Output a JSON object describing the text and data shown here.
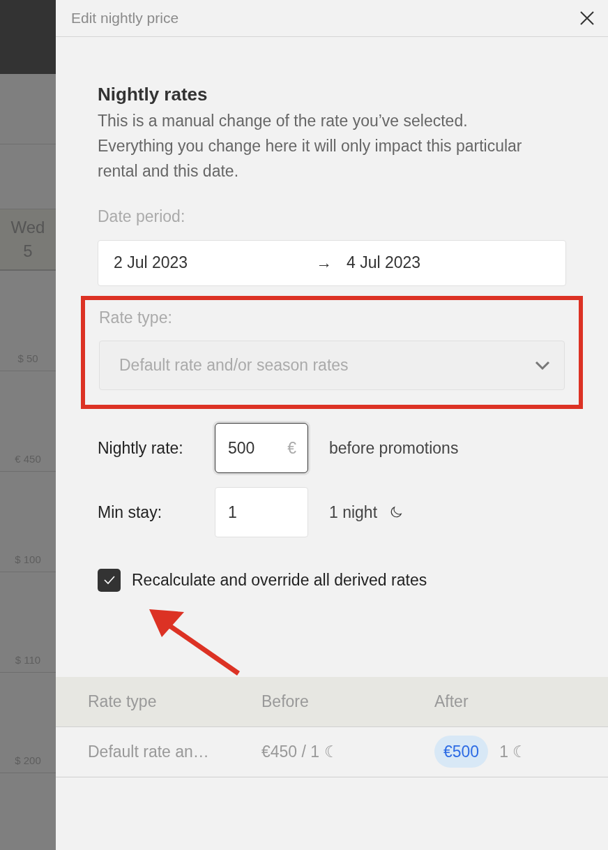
{
  "calendar": {
    "day": {
      "weekday": "Wed",
      "date": "5"
    },
    "prices": [
      "$ 50",
      "€ 450",
      "$ 100",
      "$ 110",
      "$ 200"
    ]
  },
  "dialog": {
    "title": "Edit nightly price",
    "heading": "Nightly rates",
    "description": "This is a manual change of the rate you’ve selected. Everything you change here it will only impact this particular rental and this date.",
    "date_period": {
      "label": "Date period:",
      "start": "2 Jul 2023",
      "arrow": "→",
      "end": "4 Jul 2023"
    },
    "rate_type": {
      "label": "Rate type:",
      "value": "Default rate and/or season rates",
      "disabled": true,
      "highlighted": true
    },
    "nightly_rate": {
      "label": "Nightly rate:",
      "value": "500",
      "currency": "€",
      "focused": true,
      "note": "before promotions"
    },
    "min_stay": {
      "label": "Min stay:",
      "value": "1",
      "focused": false,
      "note": "1 night"
    },
    "recalculate": {
      "label": "Recalculate and override all derived rates",
      "checked": true
    },
    "table": {
      "columns": [
        "Rate type",
        "Before",
        "After"
      ],
      "rows": [
        {
          "rate_type": "Default rate an…",
          "before": "€450 / 1 ☾",
          "after": "€500",
          "after_nights": "1 ☾"
        }
      ]
    }
  }
}
